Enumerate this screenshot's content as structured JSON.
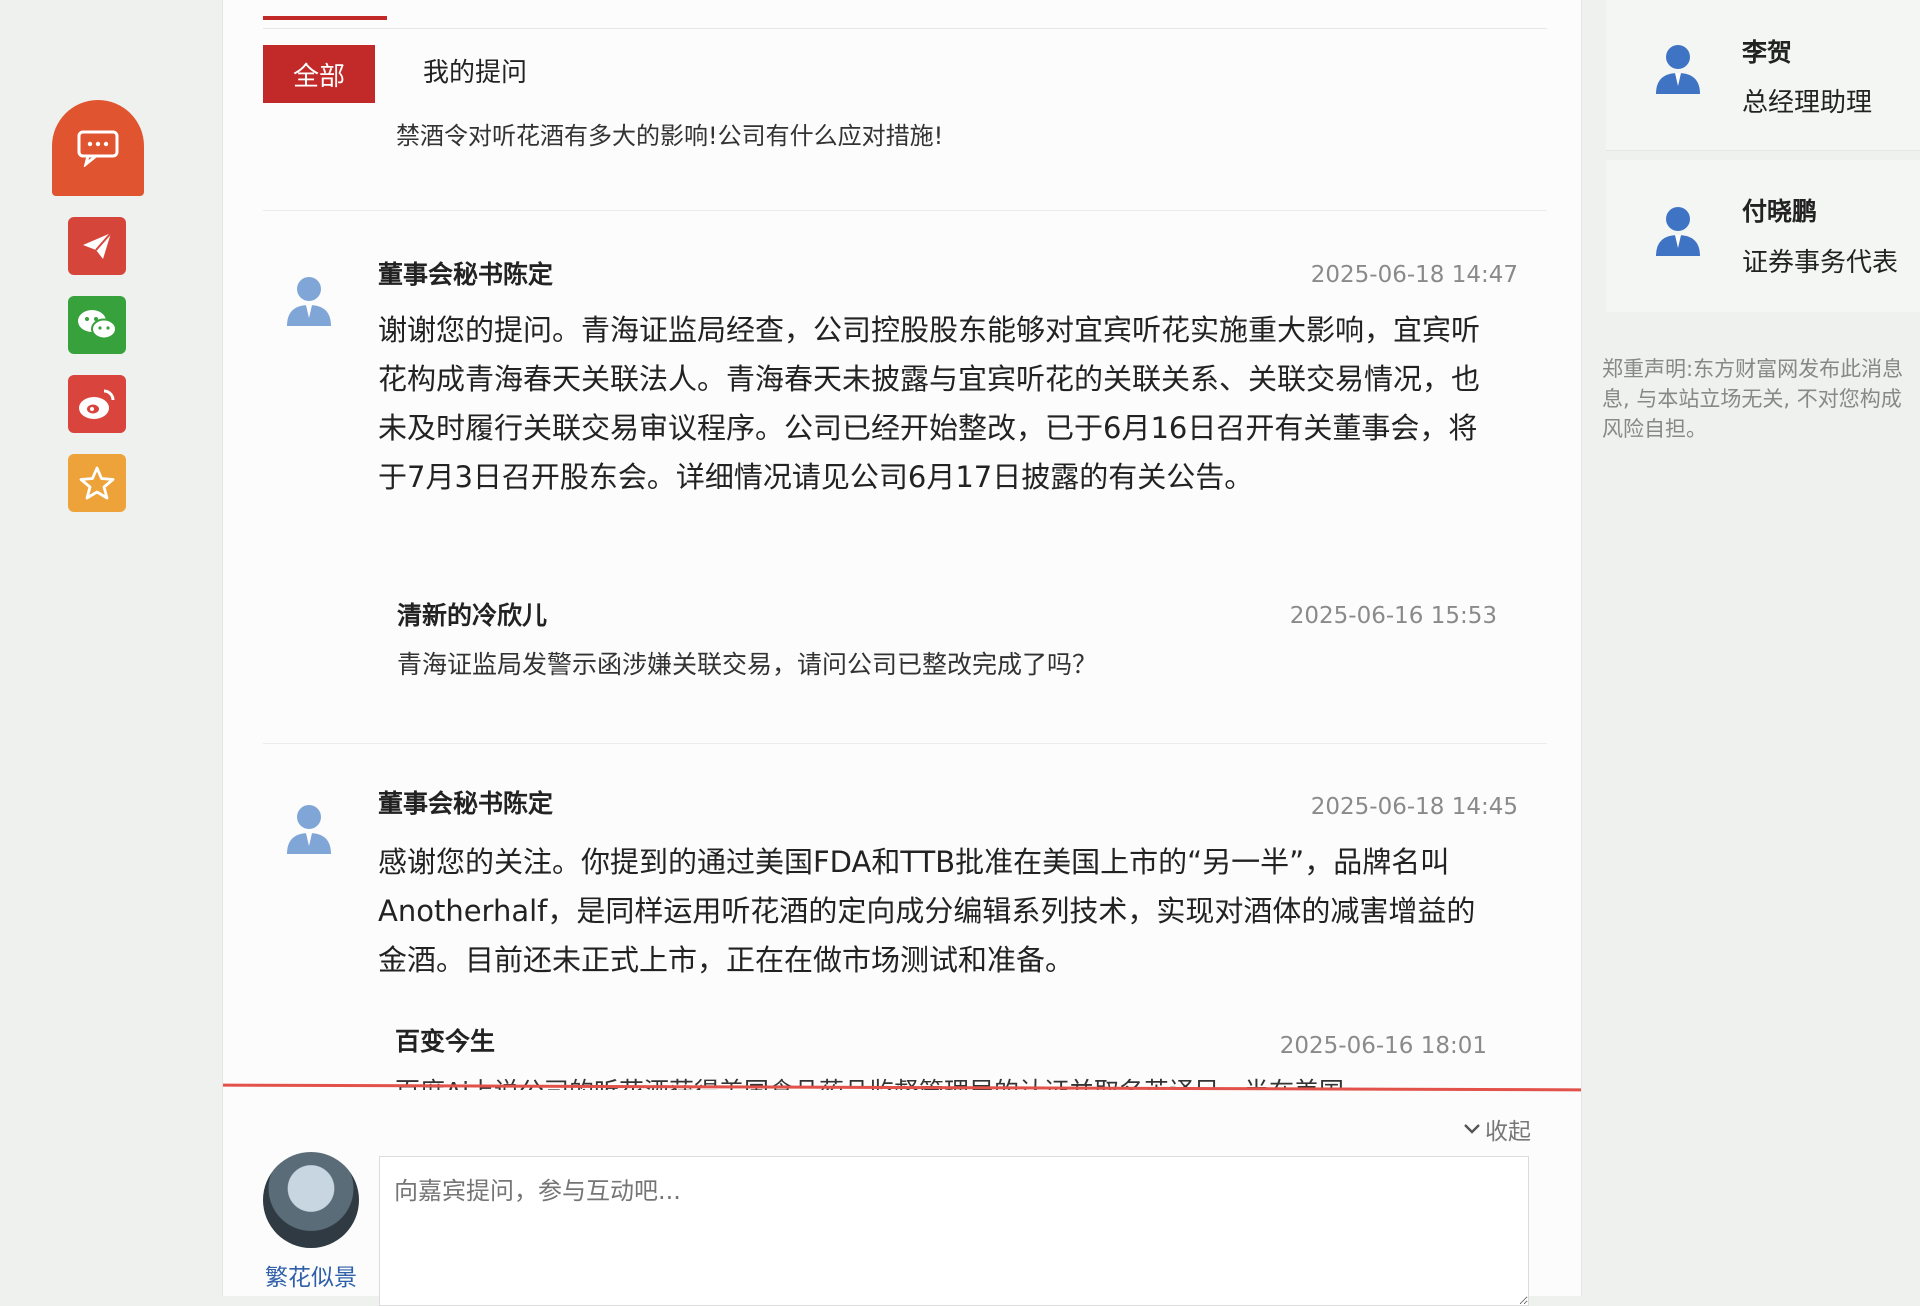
{
  "colors": {
    "brand_red": "#c22a2a",
    "rail_orange": "#e0552f",
    "wechat_green": "#37a23c",
    "weibo_red": "#d9443c",
    "favorite_orange": "#eda23a",
    "link_blue": "#2f5fa8"
  },
  "rail": {
    "icons": [
      "comment-icon",
      "telegram-icon",
      "wechat-icon",
      "weibo-icon",
      "star-icon"
    ]
  },
  "tabs": {
    "all": "全部",
    "mine": "我的提问"
  },
  "top_question": "禁酒令对听花酒有多大的影响!公司有什么应对措施!",
  "threads": [
    {
      "responder": "董事会秘书陈定",
      "answer_time": "2025-06-18 14:47",
      "answer": "谢谢您的提问。青海证监局经查，公司控股股东能够对宜宾听花实施重大影响，宜宾听花构成青海春天关联法人。青海春天未披露与宜宾听花的关联关系、关联交易情况，也未及时履行关联交易审议程序。公司已经开始整改，已于6月16日召开有关董事会，将于7月3日召开股东会。详细情况请见公司6月17日披露的有关公告。",
      "asker": "清新的冷欣儿",
      "ask_time": "2025-06-16 15:53",
      "question": "青海证监局发警示函涉嫌关联交易，请问公司已整改完成了吗？"
    },
    {
      "responder": "董事会秘书陈定",
      "answer_time": "2025-06-18 14:45",
      "answer": "感谢您的关注。你提到的通过美国FDA和TTB批准在美国上市的“另一半”，品牌名叫Anotherhalf，是同样运用听花酒的定向成分编辑系列技术，实现对酒体的减害增益的金酒。目前还未正式上市，正在在做市场测试和准备。",
      "asker": "百变今生",
      "ask_time": "2025-06-16 18:01",
      "question": "百度Ai上说公司的听花酒获得美国食品药品监督管理局的认证并取名英译另一半在美国"
    }
  ],
  "collapse_label": "收起",
  "composer": {
    "placeholder": "向嘉宾提问，参与互动吧...",
    "user_name": "繁花似景"
  },
  "guests": [
    {
      "name": "李贺",
      "title": "总经理助理"
    },
    {
      "name": "付晓鹏",
      "title": "证券事务代表"
    }
  ],
  "disclaimer": "郑重声明:东方财富网发布此消息\n息, 与本站立场无关, 不对您构成\n风险自担。"
}
